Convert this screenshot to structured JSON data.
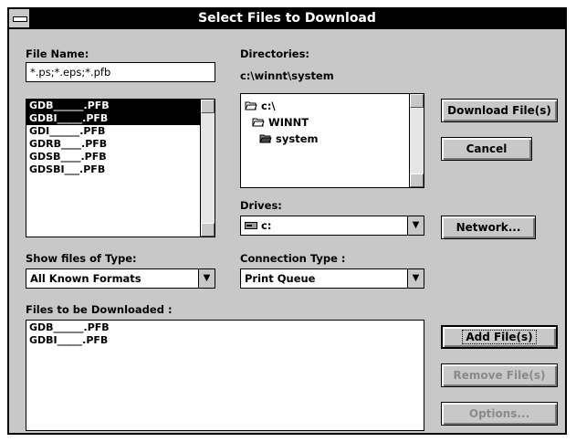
{
  "window": {
    "title": "Select Files to Download"
  },
  "file_name": {
    "label": "File Name:",
    "value": "*.ps;*.eps;*.pfb",
    "files": [
      {
        "label": "GDB______.PFB",
        "selected": true
      },
      {
        "label": "GDBI_____.PFB",
        "selected": true
      },
      {
        "label": "GDI______.PFB",
        "selected": false
      },
      {
        "label": "GDRB____.PFB",
        "selected": false
      },
      {
        "label": "GDSB____.PFB",
        "selected": false
      },
      {
        "label": "GDSBI___.PFB",
        "selected": false
      }
    ]
  },
  "directories": {
    "label": "Directories:",
    "current": "c:\\winnt\\system",
    "items": [
      {
        "label": "c:\\",
        "icon": "open-folder-icon"
      },
      {
        "label": "WINNT",
        "icon": "open-folder-icon"
      },
      {
        "label": "system",
        "icon": "open-folder-icon"
      }
    ]
  },
  "drives": {
    "label": "Drives:",
    "value": "c:"
  },
  "file_type": {
    "label": "Show files of Type:",
    "value": "All Known Formats"
  },
  "connection": {
    "label": "Connection Type :",
    "value": "Print Queue"
  },
  "download_list": {
    "label": "Files to be Downloaded :",
    "items": [
      "GDB______.PFB",
      "GDBI_____.PFB"
    ]
  },
  "buttons": {
    "download": "Download File(s)",
    "cancel": "Cancel",
    "network": "Network...",
    "add": "Add File(s)",
    "remove": "Remove File(s)",
    "options": "Options..."
  }
}
